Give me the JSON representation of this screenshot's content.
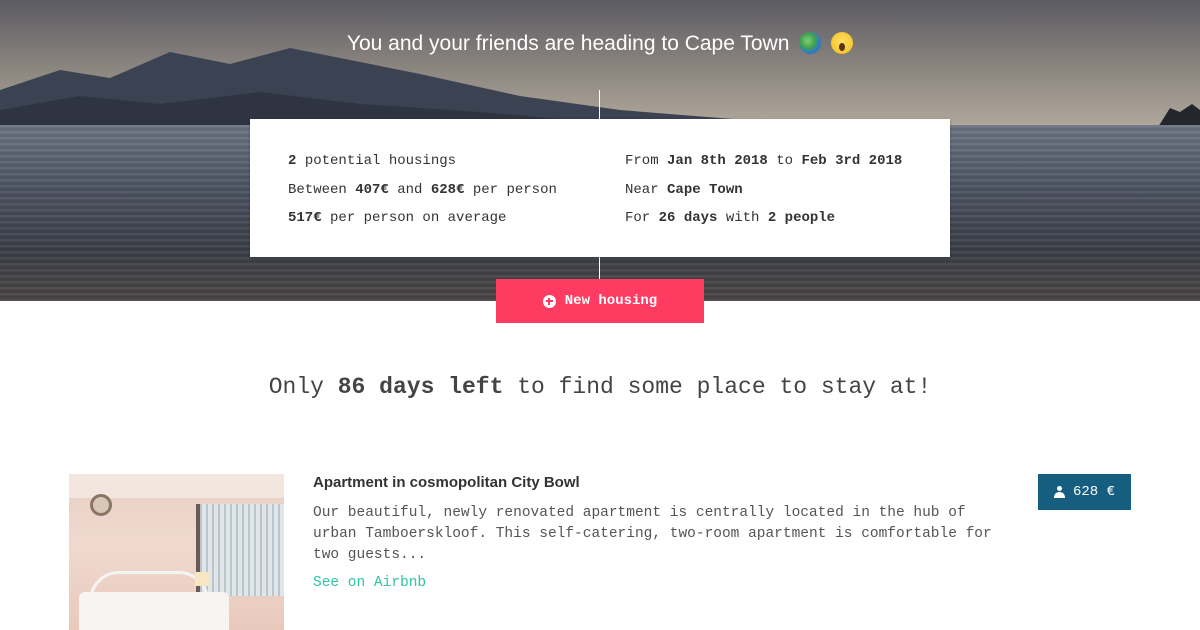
{
  "hero": {
    "title": "You and your friends are heading to Cape Town",
    "emojis": [
      "globe-africa-emoji",
      "face-screaming-emoji"
    ]
  },
  "summary": {
    "housings_count": "2",
    "housings_label": "potential housings",
    "between_label": "Between",
    "price_min": "407€",
    "and_label": "and",
    "price_max": "628€",
    "per_person_label": "per person",
    "price_average": "517€",
    "average_label": "per person on average",
    "from_label": "From",
    "date_start": "Jan 8th 2018",
    "to_label": "to",
    "date_end": "Feb 3rd 2018",
    "near_label": "Near",
    "location": "Cape Town",
    "for_label": "For",
    "duration": "26 days",
    "with_label": "with",
    "people": "2 people"
  },
  "actions": {
    "new_housing_label": "New housing"
  },
  "countdown": {
    "prefix": "Only",
    "highlight": "86 days left",
    "suffix": "to find some place to stay at!"
  },
  "listings": [
    {
      "title": "Apartment in cosmopolitan City Bowl",
      "description": "Our beautiful, newly renovated apartment is centrally located in the hub of urban Tamboerskloof. This self-catering, two-room apartment is comfortable for two guests...",
      "link_label": "See on Airbnb",
      "price": "628 €"
    }
  ],
  "colors": {
    "accent": "#ff3b61",
    "price_badge": "#155e80",
    "link": "#2ec4a6"
  }
}
